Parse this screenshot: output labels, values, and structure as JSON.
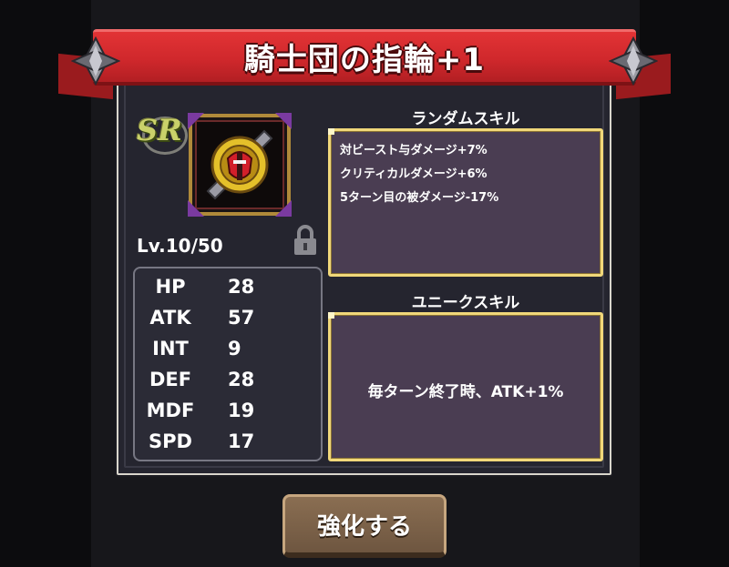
{
  "title": "騎士団の指輪+1",
  "rarity": "SR",
  "level_text": "Lv.10/50",
  "stats": [
    {
      "label": "HP",
      "value": "28"
    },
    {
      "label": "ATK",
      "value": "57"
    },
    {
      "label": "INT",
      "value": "9"
    },
    {
      "label": "DEF",
      "value": "28"
    },
    {
      "label": "MDF",
      "value": "19"
    },
    {
      "label": "SPD",
      "value": "17"
    }
  ],
  "random_skill": {
    "title": "ランダムスキル",
    "lines": [
      "対ビースト与ダメージ+7%",
      "クリティカルダメージ+6%",
      "5ターン目の被ダメージ-17%"
    ]
  },
  "unique_skill": {
    "title": "ユニークスキル",
    "text": "毎ターン終了時、ATK+1%"
  },
  "enhance_button": "強化する",
  "icons": {
    "lock": "lock-icon",
    "item": "ring-item-icon",
    "spikes": "spike-ornament-icon"
  },
  "colors": {
    "banner": "#d0282c",
    "skill_border": "#f1d87a",
    "skill_bg": "#4a3d52",
    "panel_bg": "#25252f",
    "button": "#7a6148"
  }
}
